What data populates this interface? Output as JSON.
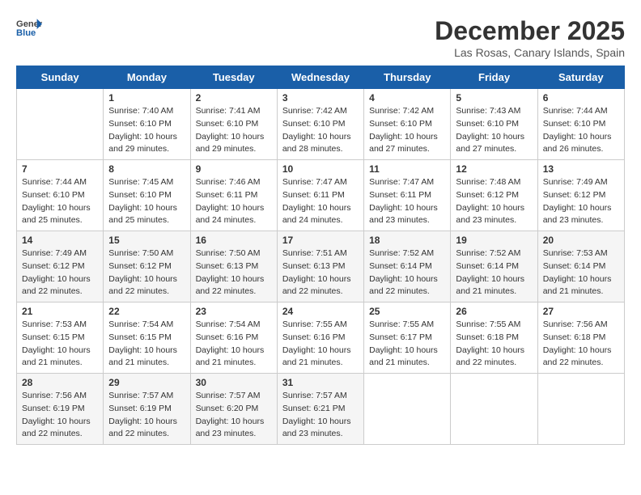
{
  "header": {
    "logo_general": "General",
    "logo_blue": "Blue",
    "month_title": "December 2025",
    "subtitle": "Las Rosas, Canary Islands, Spain"
  },
  "weekdays": [
    "Sunday",
    "Monday",
    "Tuesday",
    "Wednesday",
    "Thursday",
    "Friday",
    "Saturday"
  ],
  "weeks": [
    [
      {
        "day": "",
        "sunrise": "",
        "sunset": "",
        "daylight": ""
      },
      {
        "day": "1",
        "sunrise": "Sunrise: 7:40 AM",
        "sunset": "Sunset: 6:10 PM",
        "daylight": "Daylight: 10 hours and 29 minutes."
      },
      {
        "day": "2",
        "sunrise": "Sunrise: 7:41 AM",
        "sunset": "Sunset: 6:10 PM",
        "daylight": "Daylight: 10 hours and 29 minutes."
      },
      {
        "day": "3",
        "sunrise": "Sunrise: 7:42 AM",
        "sunset": "Sunset: 6:10 PM",
        "daylight": "Daylight: 10 hours and 28 minutes."
      },
      {
        "day": "4",
        "sunrise": "Sunrise: 7:42 AM",
        "sunset": "Sunset: 6:10 PM",
        "daylight": "Daylight: 10 hours and 27 minutes."
      },
      {
        "day": "5",
        "sunrise": "Sunrise: 7:43 AM",
        "sunset": "Sunset: 6:10 PM",
        "daylight": "Daylight: 10 hours and 27 minutes."
      },
      {
        "day": "6",
        "sunrise": "Sunrise: 7:44 AM",
        "sunset": "Sunset: 6:10 PM",
        "daylight": "Daylight: 10 hours and 26 minutes."
      }
    ],
    [
      {
        "day": "7",
        "sunrise": "Sunrise: 7:44 AM",
        "sunset": "Sunset: 6:10 PM",
        "daylight": "Daylight: 10 hours and 25 minutes."
      },
      {
        "day": "8",
        "sunrise": "Sunrise: 7:45 AM",
        "sunset": "Sunset: 6:10 PM",
        "daylight": "Daylight: 10 hours and 25 minutes."
      },
      {
        "day": "9",
        "sunrise": "Sunrise: 7:46 AM",
        "sunset": "Sunset: 6:11 PM",
        "daylight": "Daylight: 10 hours and 24 minutes."
      },
      {
        "day": "10",
        "sunrise": "Sunrise: 7:47 AM",
        "sunset": "Sunset: 6:11 PM",
        "daylight": "Daylight: 10 hours and 24 minutes."
      },
      {
        "day": "11",
        "sunrise": "Sunrise: 7:47 AM",
        "sunset": "Sunset: 6:11 PM",
        "daylight": "Daylight: 10 hours and 23 minutes."
      },
      {
        "day": "12",
        "sunrise": "Sunrise: 7:48 AM",
        "sunset": "Sunset: 6:12 PM",
        "daylight": "Daylight: 10 hours and 23 minutes."
      },
      {
        "day": "13",
        "sunrise": "Sunrise: 7:49 AM",
        "sunset": "Sunset: 6:12 PM",
        "daylight": "Daylight: 10 hours and 23 minutes."
      }
    ],
    [
      {
        "day": "14",
        "sunrise": "Sunrise: 7:49 AM",
        "sunset": "Sunset: 6:12 PM",
        "daylight": "Daylight: 10 hours and 22 minutes."
      },
      {
        "day": "15",
        "sunrise": "Sunrise: 7:50 AM",
        "sunset": "Sunset: 6:12 PM",
        "daylight": "Daylight: 10 hours and 22 minutes."
      },
      {
        "day": "16",
        "sunrise": "Sunrise: 7:50 AM",
        "sunset": "Sunset: 6:13 PM",
        "daylight": "Daylight: 10 hours and 22 minutes."
      },
      {
        "day": "17",
        "sunrise": "Sunrise: 7:51 AM",
        "sunset": "Sunset: 6:13 PM",
        "daylight": "Daylight: 10 hours and 22 minutes."
      },
      {
        "day": "18",
        "sunrise": "Sunrise: 7:52 AM",
        "sunset": "Sunset: 6:14 PM",
        "daylight": "Daylight: 10 hours and 22 minutes."
      },
      {
        "day": "19",
        "sunrise": "Sunrise: 7:52 AM",
        "sunset": "Sunset: 6:14 PM",
        "daylight": "Daylight: 10 hours and 21 minutes."
      },
      {
        "day": "20",
        "sunrise": "Sunrise: 7:53 AM",
        "sunset": "Sunset: 6:14 PM",
        "daylight": "Daylight: 10 hours and 21 minutes."
      }
    ],
    [
      {
        "day": "21",
        "sunrise": "Sunrise: 7:53 AM",
        "sunset": "Sunset: 6:15 PM",
        "daylight": "Daylight: 10 hours and 21 minutes."
      },
      {
        "day": "22",
        "sunrise": "Sunrise: 7:54 AM",
        "sunset": "Sunset: 6:15 PM",
        "daylight": "Daylight: 10 hours and 21 minutes."
      },
      {
        "day": "23",
        "sunrise": "Sunrise: 7:54 AM",
        "sunset": "Sunset: 6:16 PM",
        "daylight": "Daylight: 10 hours and 21 minutes."
      },
      {
        "day": "24",
        "sunrise": "Sunrise: 7:55 AM",
        "sunset": "Sunset: 6:16 PM",
        "daylight": "Daylight: 10 hours and 21 minutes."
      },
      {
        "day": "25",
        "sunrise": "Sunrise: 7:55 AM",
        "sunset": "Sunset: 6:17 PM",
        "daylight": "Daylight: 10 hours and 21 minutes."
      },
      {
        "day": "26",
        "sunrise": "Sunrise: 7:55 AM",
        "sunset": "Sunset: 6:18 PM",
        "daylight": "Daylight: 10 hours and 22 minutes."
      },
      {
        "day": "27",
        "sunrise": "Sunrise: 7:56 AM",
        "sunset": "Sunset: 6:18 PM",
        "daylight": "Daylight: 10 hours and 22 minutes."
      }
    ],
    [
      {
        "day": "28",
        "sunrise": "Sunrise: 7:56 AM",
        "sunset": "Sunset: 6:19 PM",
        "daylight": "Daylight: 10 hours and 22 minutes."
      },
      {
        "day": "29",
        "sunrise": "Sunrise: 7:57 AM",
        "sunset": "Sunset: 6:19 PM",
        "daylight": "Daylight: 10 hours and 22 minutes."
      },
      {
        "day": "30",
        "sunrise": "Sunrise: 7:57 AM",
        "sunset": "Sunset: 6:20 PM",
        "daylight": "Daylight: 10 hours and 23 minutes."
      },
      {
        "day": "31",
        "sunrise": "Sunrise: 7:57 AM",
        "sunset": "Sunset: 6:21 PM",
        "daylight": "Daylight: 10 hours and 23 minutes."
      },
      {
        "day": "",
        "sunrise": "",
        "sunset": "",
        "daylight": ""
      },
      {
        "day": "",
        "sunrise": "",
        "sunset": "",
        "daylight": ""
      },
      {
        "day": "",
        "sunrise": "",
        "sunset": "",
        "daylight": ""
      }
    ]
  ]
}
